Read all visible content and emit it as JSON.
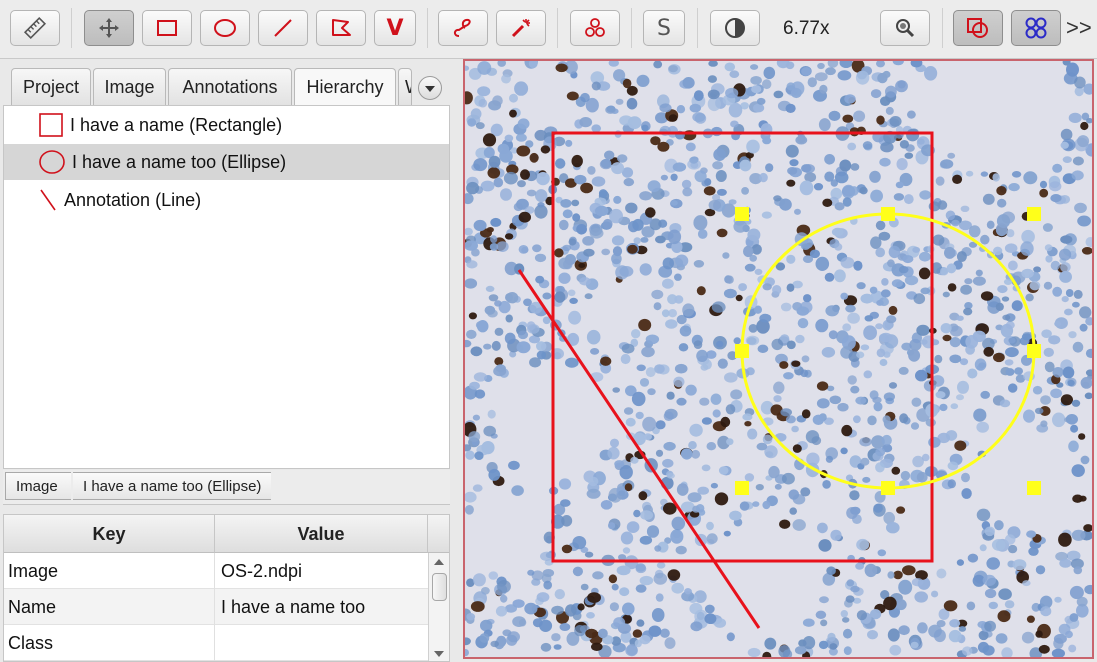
{
  "toolbar": {
    "zoom_label": "6.77x",
    "brush_letter": "V",
    "selection_letter": "S",
    "more_label": ">>",
    "accent_color": "#d0111b",
    "tools": [
      {
        "icon": "ruler-icon",
        "selected": false
      },
      {
        "icon": "move-icon",
        "selected": true
      },
      {
        "icon": "rectangle-icon",
        "selected": false
      },
      {
        "icon": "ellipse-icon",
        "selected": false
      },
      {
        "icon": "line-icon",
        "selected": false
      },
      {
        "icon": "polygon-icon",
        "selected": false
      },
      {
        "icon": "brush-icon",
        "selected": false
      },
      {
        "icon": "wand-icon",
        "selected": false
      },
      {
        "icon": "points-icon",
        "selected": false
      },
      {
        "icon": "selection-mode-icon",
        "selected": false
      },
      {
        "icon": "contrast-icon",
        "selected": false
      },
      {
        "icon": "zoom-to-fit-icon",
        "selected": false
      },
      {
        "icon": "show-annotations-icon",
        "selected": true
      },
      {
        "icon": "show-detections-icon",
        "selected": true
      }
    ]
  },
  "tabs": [
    {
      "label": "Project",
      "active": false
    },
    {
      "label": "Image",
      "active": false
    },
    {
      "label": "Annotations",
      "active": false
    },
    {
      "label": "Hierarchy",
      "active": true
    },
    {
      "label": "W",
      "active": false
    }
  ],
  "hierarchy": {
    "items": [
      {
        "label": "I have a name (Rectangle)",
        "shape": "rectangle-icon",
        "selected": false
      },
      {
        "label": "I have a name too (Ellipse)",
        "shape": "ellipse-icon",
        "selected": true
      },
      {
        "label": "Annotation (Line)",
        "shape": "line-icon",
        "selected": false
      }
    ]
  },
  "breadcrumb": [
    "Image",
    "I have a name too (Ellipse)"
  ],
  "properties": {
    "headers": {
      "key": "Key",
      "value": "Value"
    },
    "rows": [
      {
        "key": "Image",
        "value": "OS-2.ndpi"
      },
      {
        "key": "Name",
        "value": "I have a name too"
      },
      {
        "key": "Class",
        "value": ""
      }
    ]
  },
  "viewer": {
    "rectangle_color": "#e8121c",
    "ellipse_color": "#ffff1a",
    "line_color": "#e8121c",
    "border_color": "#c9646d"
  }
}
